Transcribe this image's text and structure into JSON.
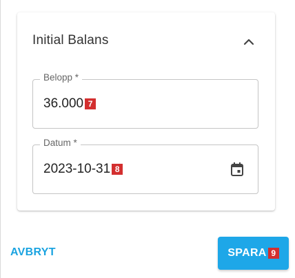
{
  "card": {
    "title": "Initial Balans",
    "collapse_icon": "chevron-up-icon"
  },
  "fields": {
    "amount": {
      "label": "Belopp *",
      "value": "36.000",
      "marker": "7"
    },
    "date": {
      "label": "Datum *",
      "value": "2023-10-31",
      "marker": "8",
      "icon": "calendar-icon"
    }
  },
  "actions": {
    "cancel_label": "AVBRYT",
    "save_label": "SPARA",
    "save_marker": "9"
  },
  "colors": {
    "accent": "#1ea7e8",
    "marker": "#d32f2f"
  }
}
